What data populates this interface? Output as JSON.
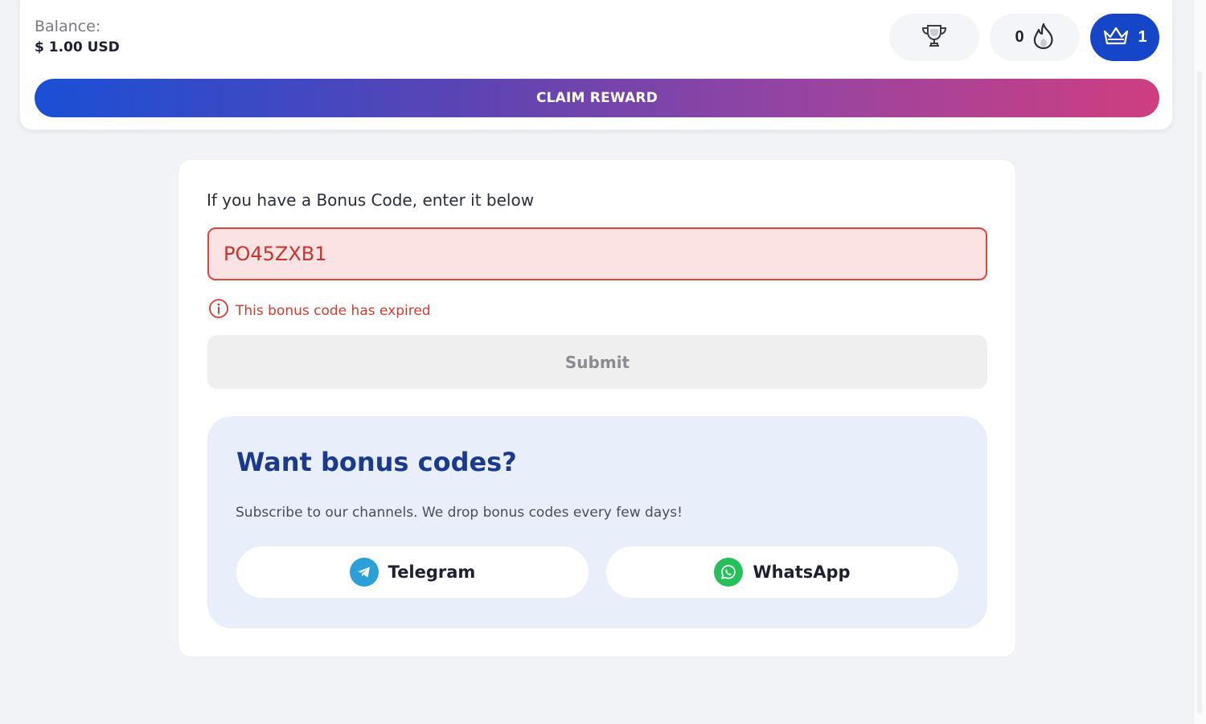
{
  "header": {
    "balance_label": "Balance:",
    "balance_value": "$ 1.00 USD",
    "trophy_icon": "trophy-icon",
    "fire_count": "0",
    "fire_icon": "fire-icon",
    "crown_count": "1",
    "crown_icon": "crown-icon",
    "claim_label": "CLAIM REWARD"
  },
  "bonus": {
    "intro": "If you have a Bonus Code, enter it below",
    "code_value": "PO45ZXB1",
    "error_icon": "info-icon",
    "error_text": "This bonus code has expired",
    "submit_label": "Submit"
  },
  "promo": {
    "title": "Want bonus codes?",
    "subtitle": "Subscribe to our channels. We drop bonus codes every few days!",
    "telegram_label": "Telegram",
    "whatsapp_label": "WhatsApp"
  },
  "colors": {
    "accent": "#1646c8",
    "error": "#d6392f",
    "promo_title": "#1a3a8f",
    "telegram": "#2a9fd8",
    "whatsapp": "#25c05a"
  }
}
